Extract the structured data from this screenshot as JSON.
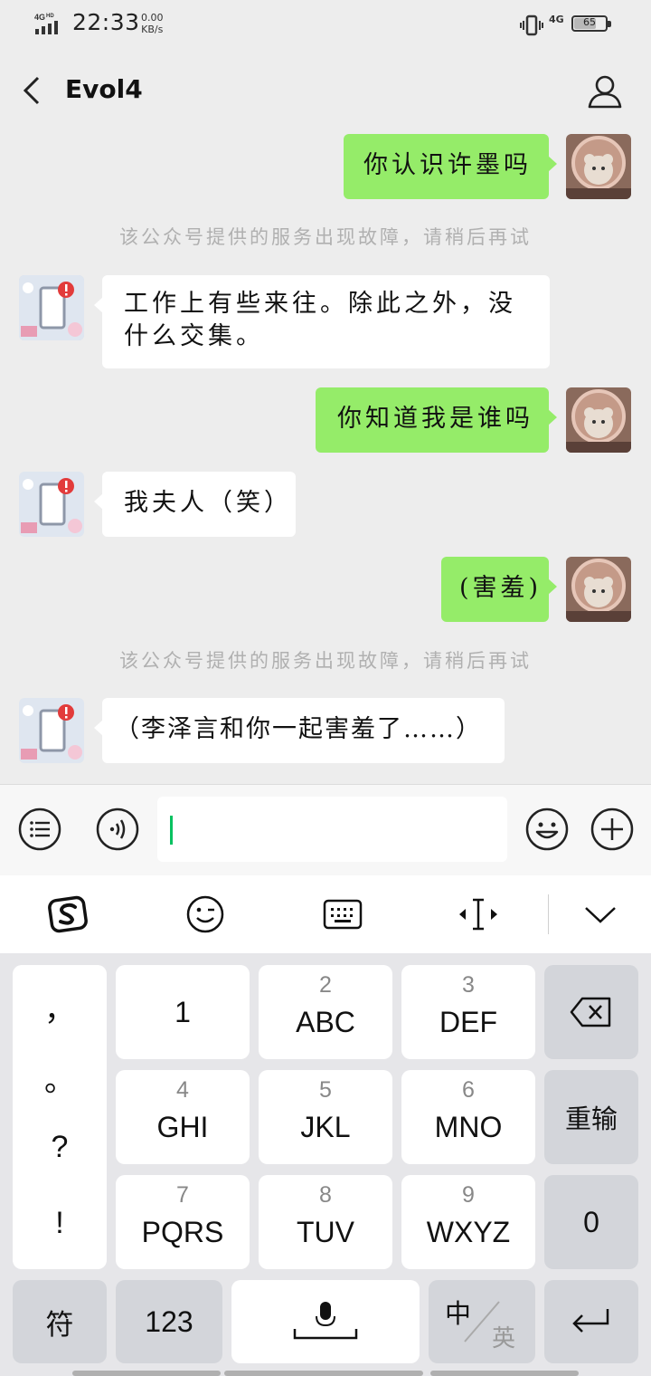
{
  "status_bar": {
    "network_left": "4G HD",
    "time": "22:33",
    "speed_value": "0.00",
    "speed_unit": "KB/s",
    "network_right": "4G",
    "battery": "65"
  },
  "header": {
    "title": "Evol4",
    "back_icon": "chevron-left-icon",
    "profile_icon": "person-icon"
  },
  "messages": [
    {
      "sender": "me",
      "text": "你认识许墨吗"
    },
    {
      "sender": "system",
      "text": "该公众号提供的服务出现故障，请稍后再试"
    },
    {
      "sender": "bot",
      "text": "工作上有些来往。除此之外，没什么交集。"
    },
    {
      "sender": "me",
      "text": "你知道我是谁吗"
    },
    {
      "sender": "bot",
      "text": "我夫人（笑）"
    },
    {
      "sender": "me",
      "text": "(害羞)"
    },
    {
      "sender": "system",
      "text": "该公众号提供的服务出现故障，请稍后再试"
    },
    {
      "sender": "bot",
      "text": "（李泽言和你一起害羞了……）"
    }
  ],
  "input_bar": {
    "menu_icon": "menu-list-icon",
    "voice_icon": "voice-icon",
    "value": "",
    "emoji_icon": "emoji-icon",
    "plus_icon": "plus-icon"
  },
  "keyboard_toolbar": {
    "icons": [
      "sogou-logo-icon",
      "wink-emoji-icon",
      "keyboard-icon",
      "cursor-move-icon",
      "chevron-down-icon"
    ]
  },
  "keyboard": {
    "punctuation": [
      "，",
      "。",
      "?",
      "!"
    ],
    "keys": [
      {
        "num": "",
        "letters": "1"
      },
      {
        "num": "2",
        "letters": "ABC"
      },
      {
        "num": "3",
        "letters": "DEF"
      },
      {
        "num": "4",
        "letters": "GHI"
      },
      {
        "num": "5",
        "letters": "JKL"
      },
      {
        "num": "6",
        "letters": "MNO"
      },
      {
        "num": "7",
        "letters": "PQRS"
      },
      {
        "num": "8",
        "letters": "TUV"
      },
      {
        "num": "9",
        "letters": "WXYZ"
      }
    ],
    "reenter": "重输",
    "zero": "0",
    "symbols": "符",
    "num_mode": "123",
    "lang_main": "中",
    "lang_alt": "英",
    "mic_icon": "microphone-icon",
    "backspace_icon": "backspace-icon",
    "enter_icon": "enter-icon",
    "colors": {
      "bubble_me": "#95ec69",
      "bubble_bot": "#ffffff",
      "cursor": "#07c160"
    }
  }
}
